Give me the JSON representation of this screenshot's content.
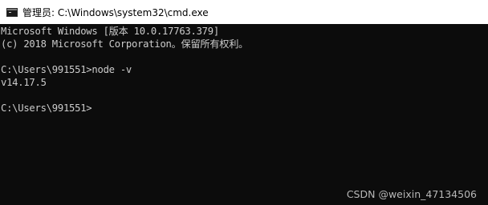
{
  "window": {
    "title": "管理员: C:\\Windows\\system32\\cmd.exe",
    "icon": "cmd-console-icon"
  },
  "console": {
    "lines": [
      "Microsoft Windows [版本 10.0.17763.379]",
      "(c) 2018 Microsoft Corporation。保留所有权利。",
      "",
      "C:\\Users\\991551>node -v",
      "v14.17.5",
      "",
      "C:\\Users\\991551>"
    ],
    "text_color": "#cccccc",
    "background": "#0c0c0c"
  },
  "watermark": {
    "text": "CSDN @weixin_47134506"
  }
}
